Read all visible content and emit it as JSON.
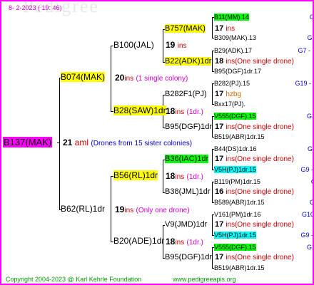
{
  "date": "8-  2-2023 ( 19: 46)",
  "watermark": "Pedigree",
  "root": {
    "name": "B137(MAK)",
    "year": "21",
    "type": "aml",
    "note": "(Drones from 15 sister colonies)"
  },
  "g1": [
    {
      "name": "B074(MAK)",
      "year": "20",
      "type": "ins",
      "note": "(1 single colony)"
    },
    {
      "name": "B62(RL)1dr",
      "year": "19",
      "type": "ins",
      "note": "(Only one drone)"
    }
  ],
  "g2": [
    {
      "name": "B100(JAL)",
      "year": "19",
      "type": "ins",
      "note": ""
    },
    {
      "name": "B28(SAW)1dr",
      "year": "18",
      "type": "ins",
      "note": "(1dr.)"
    },
    {
      "name": "B56(RL)1dr",
      "year": "18",
      "type": "ins",
      "note": "(1dr.)"
    },
    {
      "name": "B20(ADE)1dr",
      "year": "18",
      "type": "ins",
      "note": "(1dr.)"
    }
  ],
  "g3": [
    {
      "name": "B757(MAK)",
      "year": "17",
      "type": "ins"
    },
    {
      "name": "B22(ADK)1dr",
      "year": "18",
      "type": "ins(One single drone)"
    },
    {
      "name": "B282F1(PJ)",
      "year": "17",
      "type": "hzbg"
    },
    {
      "name": "B95(DGF)1dr",
      "year": "17",
      "type": "ins(One single drone)"
    },
    {
      "name": "B36(IAC)1dr",
      "year": "17",
      "type": "ins(One single drone)"
    },
    {
      "name": "B38(JML)1dr",
      "year": "16",
      "type": "ins(One single drone)"
    },
    {
      "name": "V9(JMD)1dr",
      "year": "17",
      "type": "ins(One single drone)"
    },
    {
      "name": "B95(DGF)1dr",
      "year": "17",
      "type": "ins(One single drone)"
    }
  ],
  "g4": [
    {
      "name": "B11(MM).14",
      "hl": "grn",
      "code": "G10 - E0537"
    },
    {
      "name": "B309(MAK).13",
      "hl": "",
      "code": "G20 - Sinop72R"
    },
    {
      "name": "B29(ADK).17",
      "hl": "",
      "code": "G7 - Erfoud07-1Q"
    },
    {
      "name": "B95(DGF)1dr.17",
      "hl": "",
      "code": "G27 - Sinop62R"
    },
    {
      "name": "B282(PJ).15",
      "hl": "",
      "code": "G19 - AthosSt80R"
    },
    {
      "name": "Bxx17(PJ).",
      "hl": "",
      "code": "no more"
    },
    {
      "name": "V555(DGF).15",
      "hl": "grn",
      "code": "G26 - Sinop62R"
    },
    {
      "name": "B519(ABR)1dr.15",
      "hl": "",
      "code": "G13 - NO6294R"
    },
    {
      "name": "B44(DS)1dr.16",
      "hl": "",
      "code": "G26 - Sinop62R"
    },
    {
      "name": "V5H(PJ)1dr.15",
      "hl": "cyn",
      "code": "G9 - PrimGreen00"
    },
    {
      "name": "B119(PM)1dr.15",
      "hl": "",
      "code": "G13 - NO6294R"
    },
    {
      "name": "B589(ABR)1dr.15",
      "hl": "",
      "code": "G18 - AthosSt80R"
    },
    {
      "name": "V161(PM)1dr.16",
      "hl": "",
      "code": "G10 - PrimGreen00"
    },
    {
      "name": "V5H(PJ)1dr.15",
      "hl": "cyn",
      "code": "G9 - PrimGreen00"
    },
    {
      "name": "V555(DGF).15",
      "hl": "grn",
      "code": "G26 - Sinop62R"
    },
    {
      "name": "B519(ABR)1dr.15",
      "hl": "",
      "code": "G13 - NO6294R"
    }
  ],
  "footer": {
    "copyright": "Copyright 2004-2023 @ Karl Kehrle Foundation",
    "site": "www.pedigreeapis.org"
  }
}
